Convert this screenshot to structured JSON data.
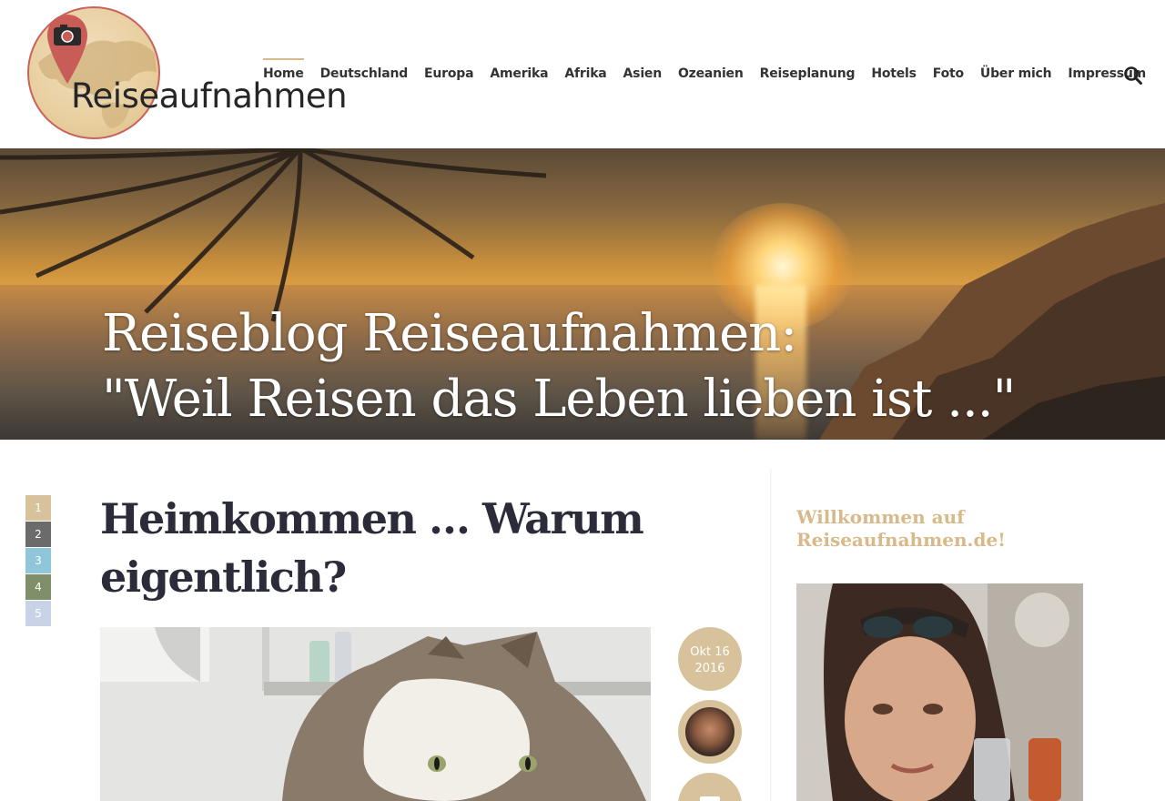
{
  "site": {
    "logo_text": "Reiseaufnahmen"
  },
  "nav": {
    "items": [
      {
        "label": "Home",
        "active": true
      },
      {
        "label": "Deutschland"
      },
      {
        "label": "Europa"
      },
      {
        "label": "Amerika"
      },
      {
        "label": "Afrika"
      },
      {
        "label": "Asien"
      },
      {
        "label": "Ozeanien"
      },
      {
        "label": "Reiseplanung"
      },
      {
        "label": "Hotels"
      },
      {
        "label": "Foto"
      },
      {
        "label": "Über mich"
      },
      {
        "label": "Impressum"
      }
    ],
    "search_icon": "search-icon"
  },
  "hero": {
    "line1": "Reiseblog Reiseaufnahmen:",
    "line2": "\"Weil Reisen das Leben lieben ist ...\""
  },
  "pager": {
    "pages": [
      "1",
      "2",
      "3",
      "4",
      "5"
    ],
    "colors": [
      "#d8c29c",
      "#6b6b6b",
      "#8fc6da",
      "#7e8f6a",
      "#c9d3e8"
    ]
  },
  "post": {
    "title": "Heimkommen … Warum eigentlich?",
    "date_line1": "Okt 16",
    "date_line2": "2016"
  },
  "sidebar": {
    "widget_title": "Willkommen auf Reiseaufnahmen.de!"
  },
  "colors": {
    "accent": "#d8b989",
    "heading": "#2b2b3a"
  }
}
